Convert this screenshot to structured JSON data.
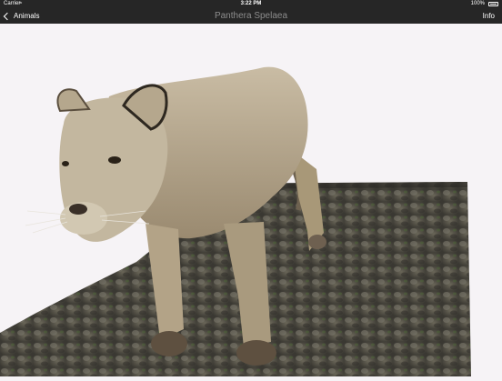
{
  "status_bar": {
    "carrier": "Carrier",
    "time": "3:22 PM",
    "battery": "100%"
  },
  "nav": {
    "back_label": "Animals",
    "title": "Panthera Spelaea",
    "info_label": "Info"
  },
  "scene": {
    "background_color": "#f6f3f6",
    "ground_color": "#4a4840",
    "animal_color": "#b8a990"
  },
  "icons": [
    "wifi-icon",
    "battery-icon",
    "chevron-left-icon"
  ]
}
